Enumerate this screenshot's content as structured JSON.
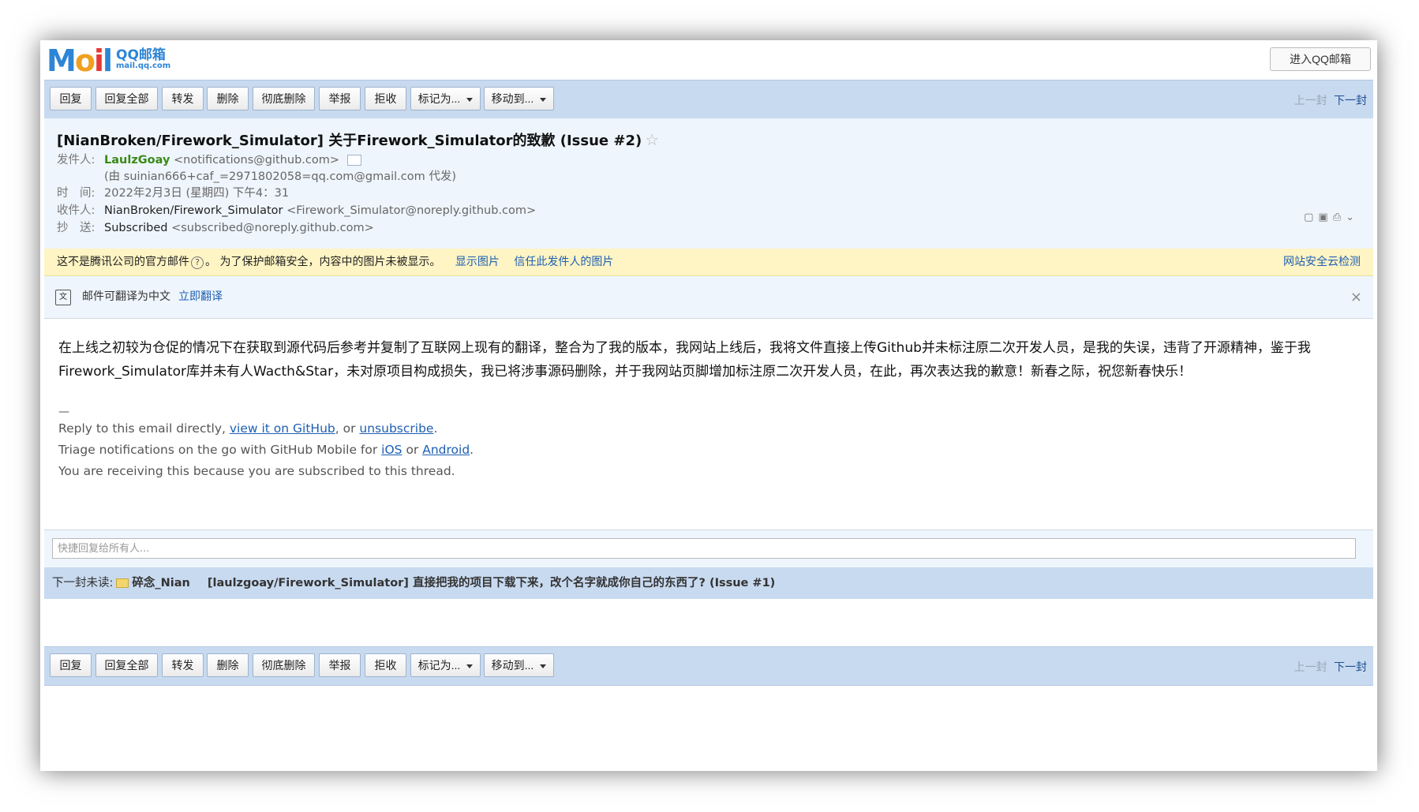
{
  "logo": {
    "mail": [
      "M",
      "o",
      "i",
      "l"
    ],
    "cn": "QQ邮箱",
    "en": "mail.qq.com"
  },
  "enter_button": "进入QQ邮箱",
  "toolbar": {
    "buttons": [
      "回复",
      "回复全部",
      "转发",
      "删除",
      "彻底删除",
      "举报",
      "拒收",
      "标记为...",
      "移动到..."
    ],
    "prev": "上一封",
    "next": "下一封"
  },
  "email": {
    "subject": "[NianBroken/Firework_Simulator] 关于Firework_Simulator的致歉 (Issue #2)",
    "star": "☆",
    "from_label": "发件人:",
    "from_name": "LaulzGoay",
    "from_addr": "<notifications@github.com>",
    "proxy": "(由 suinian666+caf_=2971802058=qq.com@gmail.com 代发)",
    "time_label": "时　间:",
    "time": "2022年2月3日 (星期四) 下午4：31",
    "to_label": "收件人:",
    "to_name": "NianBroken/Firework_Simulator",
    "to_addr": "<Firework_Simulator@noreply.github.com>",
    "cc_label": "抄　送:",
    "cc_name": "Subscribed",
    "cc_addr": "<subscribed@noreply.github.com>"
  },
  "warning": {
    "text1": "这不是腾讯公司的官方邮件",
    "q": "?",
    "text2": "。 为了保护邮箱安全，内容中的图片未被显示。",
    "show_images": "显示图片",
    "trust_sender": "信任此发件人的图片",
    "security": "网站安全云检测"
  },
  "translate": {
    "text": "邮件可翻译为中文",
    "action": "立即翻译",
    "close": "×"
  },
  "body": {
    "paragraph": "在上线之初较为仓促的情况下在获取到源代码后参考并复制了互联网上现有的翻译，整合为了我的版本，我网站上线后，我将文件直接上传Github并未标注原二次开发人员，是我的失误，违背了开源精神，鉴于我Firework_Simulator库并未有人Wacth&Star，未对原项目构成损失，我已将涉事源码删除，并于我网站页脚增加标注原二次开发人员，在此，再次表达我的歉意！新春之际，祝您新春快乐！",
    "dash": "—",
    "reply_pre": "Reply to this email directly, ",
    "view_link": "view it on GitHub",
    "reply_mid": ", or ",
    "unsub_link": "unsubscribe",
    "reply_end": ".",
    "triage_pre": "Triage notifications on the go with GitHub Mobile for ",
    "ios_link": "iOS",
    "triage_mid": " or ",
    "android_link": "Android",
    "triage_end": ".",
    "receiving": "You are receiving this because you are subscribed to this thread."
  },
  "quick_reply": {
    "placeholder": "快捷回复给所有人..."
  },
  "next_unread": {
    "label": "下一封未读:",
    "from": "碎念_Nian",
    "subject": "[laulzgoay/Firework_Simulator] 直接把我的项目下载下来，改个名字就成你自己的东西了? (Issue #1)"
  }
}
